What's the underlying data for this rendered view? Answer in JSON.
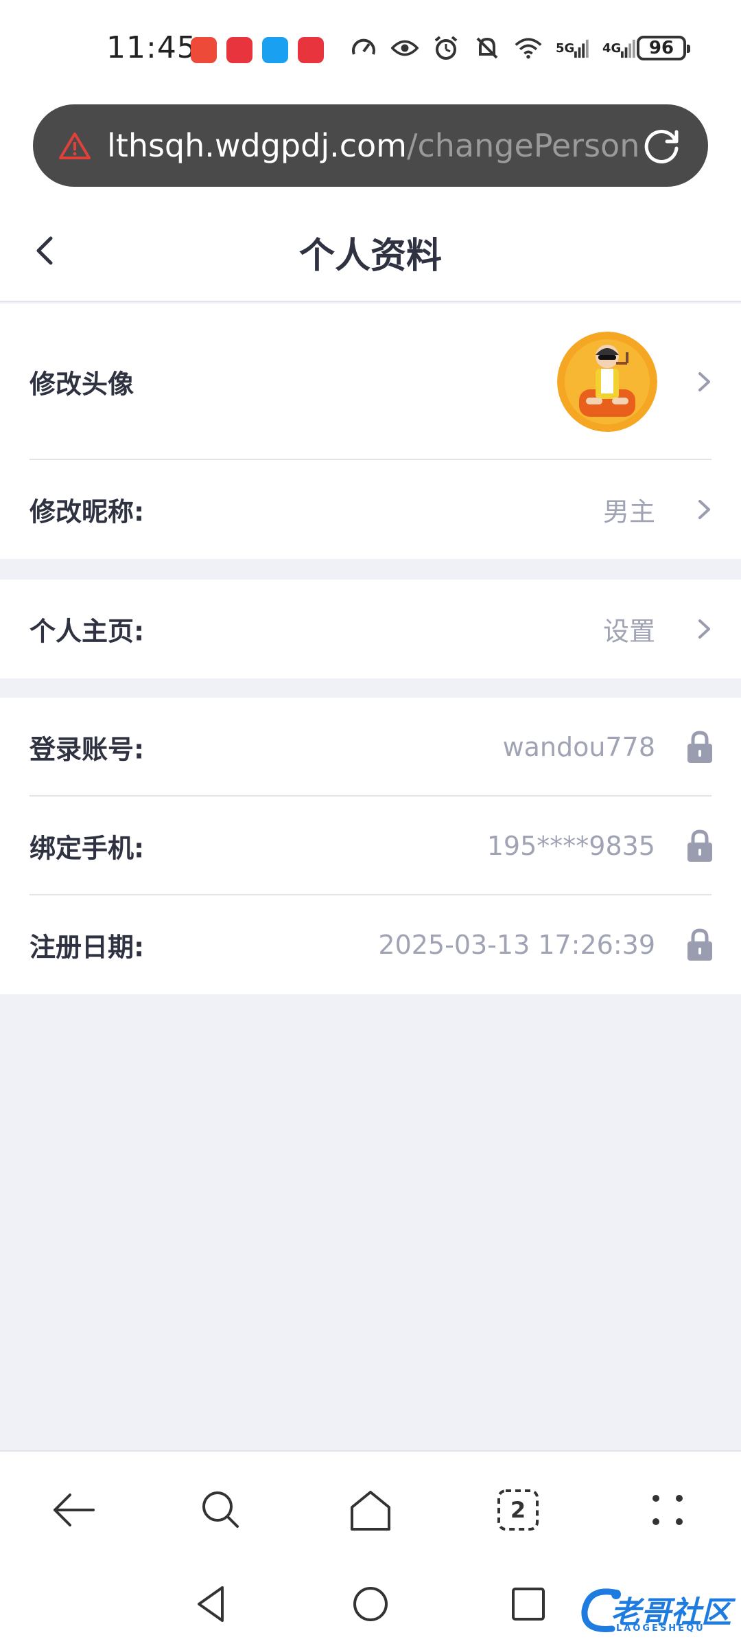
{
  "status_bar": {
    "time": "11:45",
    "battery": "96",
    "network_1": "5G",
    "network_2": "4G"
  },
  "browser": {
    "url_host": "lthsqh.wdgpdj.com",
    "url_path": "/changePerson"
  },
  "header": {
    "title": "个人资料"
  },
  "profile": {
    "avatar_label": "修改头像",
    "nickname_label": "修改昵称:",
    "nickname_value": "男主",
    "homepage_label": "个人主页:",
    "homepage_value": "设置",
    "account_label": "登录账号:",
    "account_value": "wandou778",
    "phone_label": "绑定手机:",
    "phone_value": "195****9835",
    "register_label": "注册日期:",
    "register_value": "2025-03-13 17:26:39"
  },
  "toolbar": {
    "tab_count": "2"
  },
  "watermark": {
    "text": "老哥社区",
    "sub": "LAOGESHEQU"
  },
  "colors": {
    "accent_blue": "#1e7be0",
    "value_grey": "#a0a3b3",
    "page_bg": "#f0f1f6",
    "warning_red": "#e0413a"
  }
}
